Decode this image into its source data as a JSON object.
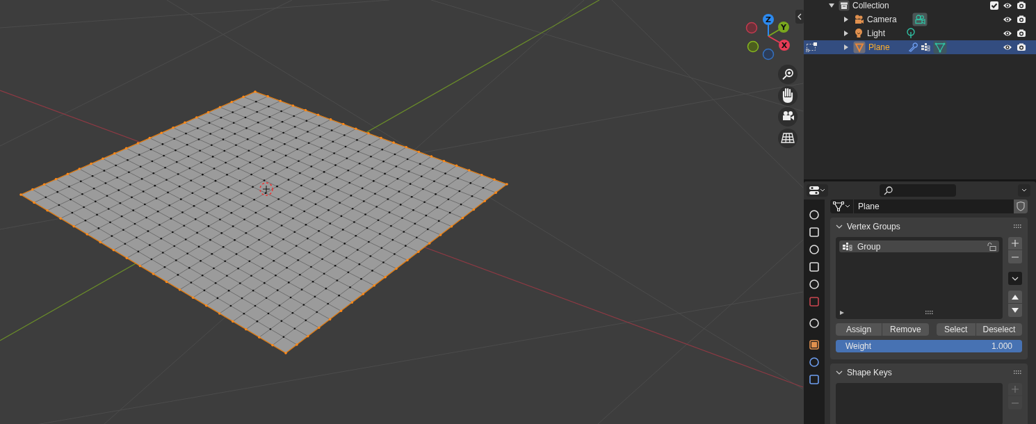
{
  "viewport": {
    "gizmo_axes": [
      {
        "label": "Z",
        "kind": "z"
      },
      {
        "label": "Y",
        "kind": "y"
      },
      {
        "label": "X",
        "kind": "x"
      }
    ]
  },
  "outliner": {
    "items": [
      {
        "name": "Collection",
        "kind": "collection",
        "checked": true,
        "expanded": true,
        "selected": false,
        "children": [
          {
            "name": "Camera",
            "kind": "camera",
            "expanded": false,
            "selected": false
          },
          {
            "name": "Light",
            "kind": "light",
            "expanded": false,
            "selected": false
          },
          {
            "name": "Plane",
            "kind": "mesh",
            "expanded": false,
            "selected": true
          }
        ]
      }
    ]
  },
  "properties": {
    "object_name": "Plane",
    "panels": [
      {
        "title": "Vertex Groups",
        "kind": "vertex_groups",
        "expanded": true,
        "groups": [
          {
            "name": "Group",
            "selected": true
          }
        ],
        "buttons": [
          "Assign",
          "Remove",
          "Select",
          "Deselect"
        ],
        "weight": {
          "label": "Weight",
          "value": "1.000",
          "level": 1
        }
      },
      {
        "title": "Shape Keys",
        "kind": "shape_keys",
        "expanded": true
      }
    ]
  }
}
